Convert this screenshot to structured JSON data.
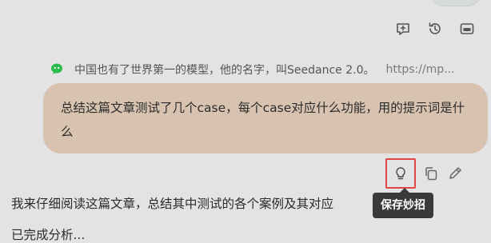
{
  "toolbar": {
    "icons": [
      "add-note-icon",
      "history-icon",
      "panel-icon"
    ]
  },
  "source": {
    "icon": "wechat-icon",
    "title": "中国也有了世界第一的模型，他的名字，叫Seedance 2.0。",
    "url": "https://mp..."
  },
  "user_message": {
    "text": "总结这篇文章测试了几个case，每个case对应什么功能，用的提示词是什么"
  },
  "message_actions": {
    "icons": [
      "lightbulb-icon",
      "copy-icon",
      "edit-icon"
    ],
    "tooltip": "保存妙招"
  },
  "assistant_message": {
    "line1": "我来仔细阅读这篇文章，总结其中测试的各个案例及其对应",
    "line2": "已完成分析..."
  },
  "colors": {
    "background": "#e3e3e3",
    "bubble": "#d8c3b1",
    "highlight": "#e04545",
    "tooltip_bg": "#3a3a3a",
    "wechat_green": "#2dbb4c"
  }
}
